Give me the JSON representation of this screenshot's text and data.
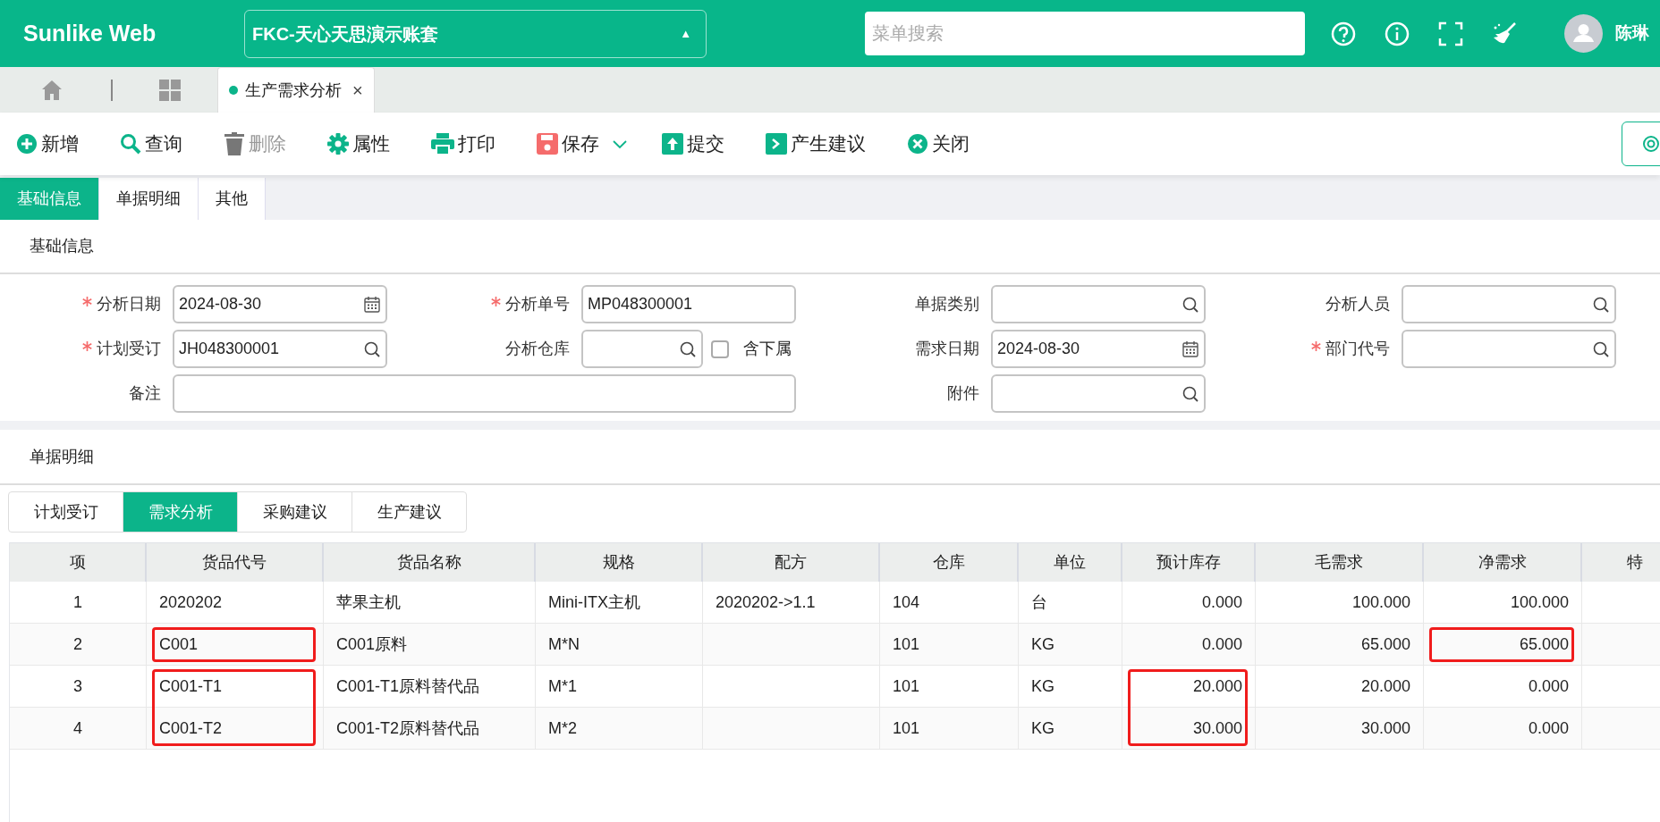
{
  "header": {
    "logo": "Sunlike Web",
    "account": {
      "value": "FKC-天心天思演示账套",
      "caret": "▲"
    },
    "search": {
      "placeholder": "菜单搜索"
    },
    "user": "陈琳"
  },
  "tabs": [
    {
      "label": "生产需求分析",
      "selected": true,
      "close": "×"
    }
  ],
  "toolbar": [
    {
      "kind": "add",
      "label": "新增",
      "disabled": false
    },
    {
      "kind": "search",
      "label": "查询",
      "disabled": false
    },
    {
      "kind": "delete",
      "label": "删除",
      "disabled": true
    },
    {
      "kind": "settings",
      "label": "属性",
      "disabled": false
    },
    {
      "kind": "print",
      "label": "打印",
      "disabled": false
    },
    {
      "kind": "save",
      "label": "保存",
      "disabled": false,
      "dropdown": true
    },
    {
      "kind": "submit",
      "label": "提交",
      "disabled": false
    },
    {
      "kind": "suggest",
      "label": "产生建议",
      "disabled": false
    },
    {
      "kind": "close",
      "label": "关闭",
      "disabled": false
    }
  ],
  "section_tabs": [
    {
      "label": "基础信息",
      "selected": true
    },
    {
      "label": "单据明细",
      "selected": false
    },
    {
      "label": "其他",
      "selected": false
    }
  ],
  "basic_info": {
    "title": "基础信息",
    "fields": [
      {
        "label": "分析日期",
        "required": true,
        "kind": "date",
        "value": "2024-08-30"
      },
      {
        "label": "分析单号",
        "required": true,
        "kind": "text",
        "value": "MP048300001"
      },
      {
        "label": "单据类别",
        "required": false,
        "kind": "lookup"
      },
      {
        "label": "分析人员",
        "required": false,
        "kind": "lookup"
      },
      {
        "label": "计划受订",
        "required": true,
        "kind": "lookup",
        "value": "JH048300001"
      },
      {
        "label": "分析仓库",
        "required": false,
        "kind": "lookup",
        "checkbox": {
          "label": "含下属",
          "checked": false
        }
      },
      {
        "label": "需求日期",
        "required": false,
        "kind": "date",
        "value": "2024-08-30"
      },
      {
        "label": "部门代号",
        "required": true,
        "kind": "lookup"
      },
      {
        "label": "备注",
        "required": false,
        "kind": "memo"
      },
      {
        "label": "附件",
        "required": false,
        "kind": "lookup"
      }
    ]
  },
  "detail": {
    "title": "单据明细",
    "tabs": [
      {
        "label": "计划受订",
        "selected": false
      },
      {
        "label": "需求分析",
        "selected": true
      },
      {
        "label": "采购建议",
        "selected": false
      },
      {
        "label": "生产建议",
        "selected": false
      }
    ],
    "table": {
      "columns": [
        {
          "label": "项",
          "kind": "index"
        },
        {
          "label": "货品代号",
          "kind": "text"
        },
        {
          "label": "货品名称",
          "kind": "text"
        },
        {
          "label": "规格",
          "kind": "text"
        },
        {
          "label": "配方",
          "kind": "text"
        },
        {
          "label": "仓库",
          "kind": "text"
        },
        {
          "label": "单位",
          "kind": "text"
        },
        {
          "label": "预计库存",
          "kind": "number"
        },
        {
          "label": "毛需求",
          "kind": "number"
        },
        {
          "label": "净需求",
          "kind": "number"
        },
        {
          "label": "特",
          "kind": "text"
        }
      ],
      "rows": [
        {
          "cells": [
            "1",
            "2020202",
            "苹果主机",
            "Mini-ITX主机",
            "2020202->1.1",
            "104",
            "台",
            "0.000",
            "100.000",
            "100.000"
          ]
        },
        {
          "cells": [
            "2",
            {
              "text": "C001",
              "boxed": true
            },
            "C001原料",
            "M*N",
            "",
            "101",
            "KG",
            "0.000",
            "65.000",
            {
              "text": "65.000",
              "boxed": true
            }
          ]
        },
        {
          "cells": [
            "3",
            {
              "text": "C001-T1",
              "boxed": true,
              "box_continues": true
            },
            "C001-T1原料替代品",
            "M*1",
            "",
            "101",
            "KG",
            {
              "text": "20.000",
              "boxed": true,
              "box_continues": true
            },
            "20.000",
            "0.000"
          ]
        },
        {
          "cells": [
            "4",
            {
              "text": "C001-T2",
              "boxed": true
            },
            "C001-T2原料替代品",
            "M*2",
            "",
            "101",
            "KG",
            {
              "text": "30.000",
              "boxed": true
            },
            "30.000",
            "0.000"
          ]
        }
      ]
    }
  }
}
